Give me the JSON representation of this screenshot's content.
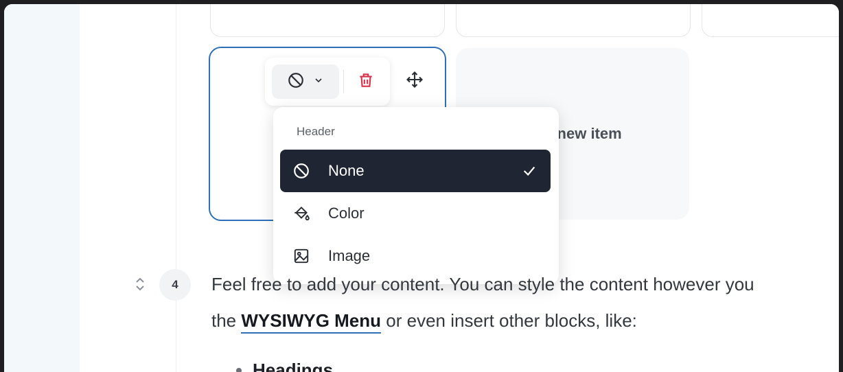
{
  "toolbar": {
    "header_style_icon": "ban-icon",
    "dropdown_icon": "chevron-down-icon",
    "delete_icon": "trash-icon",
    "move_icon": "move-arrows-icon"
  },
  "grid": {
    "add_item_label": "d new item"
  },
  "header_menu": {
    "title": "Header",
    "items": [
      {
        "label": "None",
        "icon": "ban-icon",
        "selected": true
      },
      {
        "label": "Color",
        "icon": "paint-bucket-icon",
        "selected": false
      },
      {
        "label": "Image",
        "icon": "image-icon",
        "selected": false
      }
    ]
  },
  "content": {
    "row_number": "4",
    "paragraph_line1": "Feel free to add your content. You can style the content however you",
    "paragraph_line2_prefix": "the ",
    "paragraph_link": "WYSIWYG Menu",
    "paragraph_line2_suffix": " or even insert other blocks, like:",
    "bullet_1": "Headings"
  },
  "colors": {
    "selection_border": "#2f6fba",
    "menu_active_bg": "#1f2532",
    "delete_red": "#d6334a"
  }
}
